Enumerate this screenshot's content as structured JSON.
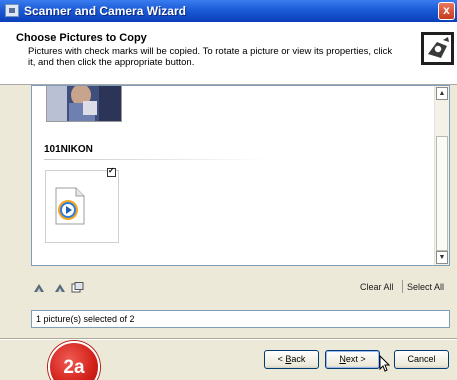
{
  "window": {
    "title": "Scanner and Camera Wizard",
    "close_label": "x"
  },
  "header": {
    "title": "Choose Pictures to Copy",
    "description": "Pictures with check marks will be copied. To rotate a picture or view its properties, click it, and then click the appropriate button."
  },
  "list": {
    "folder_name": "101NIKON",
    "items": [
      {
        "type": "photo",
        "checked": null
      },
      {
        "type": "video",
        "checked": true
      }
    ]
  },
  "toolbar": {
    "icons": [
      "rotate-left-icon",
      "rotate-right-icon",
      "properties-icon"
    ],
    "clear_all": "Clear All",
    "select_all": "Select All"
  },
  "status": {
    "text": "1 picture(s) selected of 2"
  },
  "buttons": {
    "back_prefix": "< ",
    "back_mnemonic": "B",
    "back_rest": "ack",
    "next_mnemonic": "N",
    "next_rest": "ext >",
    "cancel": "Cancel"
  },
  "badge": {
    "text": "2a"
  },
  "colors": {
    "titlebar": "#0a3fb9",
    "badge": "#d12018",
    "dialog_bg": "#ece9d8"
  }
}
